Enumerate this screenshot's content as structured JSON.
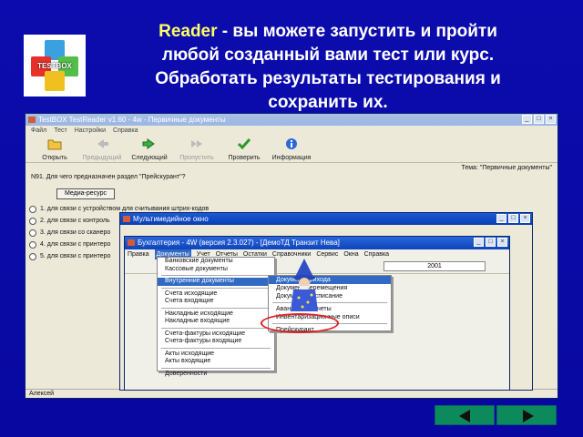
{
  "slide": {
    "title_accent": "Reader",
    "title_rest": " - вы можете запустить и пройти",
    "title_line2": "любой созданный вами тест или курс.",
    "title_line3": "Обработать результаты тестирования и",
    "title_line4": "сохранить их.",
    "logo_text": "TESTBOX"
  },
  "main_window": {
    "title": "TestBOX TestReader v1.60 - 4w - Первичные документы",
    "menu": [
      "Файл",
      "Тест",
      "Настройки",
      "Справка"
    ],
    "toolbar": [
      {
        "label": "Открыть",
        "icon": "folder-icon",
        "disabled": false
      },
      {
        "label": "Предыдущий",
        "icon": "back-arrow-icon",
        "disabled": true
      },
      {
        "label": "Следующий",
        "icon": "forward-arrow-icon",
        "disabled": false
      },
      {
        "label": "Пропустить",
        "icon": "skip-icon",
        "disabled": true
      },
      {
        "label": "Проверить",
        "icon": "check-icon",
        "disabled": false
      },
      {
        "label": "Информация",
        "icon": "info-icon",
        "disabled": false
      }
    ],
    "question": "N91.  Для чего предназначен раздел \"Прейскурант\"?",
    "topic": "Тема: \"Первичные документы\"",
    "media_button": "Медиа-ресурс",
    "answers": [
      "1. для связи с устройством для считывания штрих-кодов",
      "2. для связи с контроль",
      "3. для связи со сканеро",
      "4. для связи с принтеро",
      "5. для связи с принтеро"
    ],
    "status": "Алексей"
  },
  "multimedia_window": {
    "title": "Мультимедийное окно"
  },
  "accounting_window": {
    "title": "Бухгалтерия - 4W (версия 2.3.027) - [ДемоТД Транзит Нева]",
    "menu": [
      "Правка",
      "Документы",
      "Учет",
      "Отчеты",
      "Остатки",
      "Справочники",
      "Сервис",
      "Окна",
      "Справка"
    ],
    "selected_menu": "Документы",
    "year": "2001"
  },
  "docs_menu": {
    "groups": [
      [
        "Банковские документы",
        "Кассовые документы"
      ],
      [
        "Внутренние документы"
      ],
      [
        "Счета исходящие",
        "Счета входящие"
      ],
      [
        "Накладные исходящие",
        "Накладные входящие"
      ],
      [
        "Счета-фактуры исходящие",
        "Счета-фактуры входящие"
      ],
      [
        "Акты исходящие",
        "Акты входящие"
      ],
      [
        "Доверенности"
      ]
    ],
    "highlighted": "Внутренние документы"
  },
  "internal_submenu": {
    "items": [
      "Документ прихода",
      "Документ перемещения",
      "Документ на списание",
      "Авансовые отчеты",
      "Инвентаризационные описи",
      "Прейскурант"
    ],
    "highlighted": "Документ прихода",
    "circled": "Прейскурант"
  }
}
